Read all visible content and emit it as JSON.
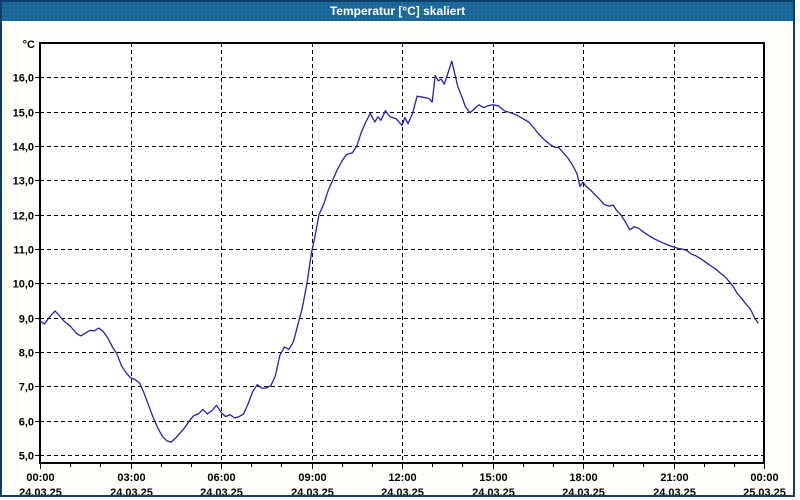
{
  "window": {
    "title": "Temperatur [°C] skaliert"
  },
  "colors": {
    "titlebar_bg": "#1e6b9e",
    "titlebar_dot": "#175c8c",
    "titlebar_text": "#ffffff",
    "window_border": "#0e3f6b",
    "content_bg": "#fdfdf9",
    "plot_bg": "#ffffff",
    "grid": "#000000",
    "axis": "#000000",
    "line": "#2222b2",
    "label": "#000000"
  },
  "chart_data": {
    "type": "line",
    "title": "Temperatur [°C] skaliert",
    "unit_label": "°C",
    "xlabel": "",
    "ylabel": "Temperatur [°C]",
    "grid": true,
    "legend": "none",
    "x_range_hours": [
      0,
      24
    ],
    "y_range": [
      4.77,
      17.0
    ],
    "minor_tick_every_hours": 1,
    "y_ticks": [
      {
        "value": 16,
        "label": "16,0"
      },
      {
        "value": 15,
        "label": "15,0"
      },
      {
        "value": 14,
        "label": "14,0"
      },
      {
        "value": 13,
        "label": "13,0"
      },
      {
        "value": 12,
        "label": "12,0"
      },
      {
        "value": 11,
        "label": "11,0"
      },
      {
        "value": 10,
        "label": "10,0"
      },
      {
        "value": 9,
        "label": "9,0"
      },
      {
        "value": 8,
        "label": "8,0"
      },
      {
        "value": 7,
        "label": "7,0"
      },
      {
        "value": 6,
        "label": "6,0"
      },
      {
        "value": 5,
        "label": "5,0"
      }
    ],
    "x_ticks": [
      {
        "hour": 0,
        "time": "00:00",
        "date": "24.03.25"
      },
      {
        "hour": 3,
        "time": "03:00",
        "date": "24.03.25"
      },
      {
        "hour": 6,
        "time": "06:00",
        "date": "24.03.25"
      },
      {
        "hour": 9,
        "time": "09:00",
        "date": "24.03.25"
      },
      {
        "hour": 12,
        "time": "12:00",
        "date": "24.03.25"
      },
      {
        "hour": 15,
        "time": "15:00",
        "date": "24.03.25"
      },
      {
        "hour": 18,
        "time": "18:00",
        "date": "24.03.25"
      },
      {
        "hour": 21,
        "time": "21:00",
        "date": "24.03.25"
      },
      {
        "hour": 24,
        "time": "00:00",
        "date": "25.03.25"
      }
    ],
    "series": [
      {
        "name": "Temperatur",
        "unit": "°C",
        "points": [
          [
            0.0,
            8.9
          ],
          [
            0.15,
            8.82
          ],
          [
            0.3,
            9.0
          ],
          [
            0.5,
            9.2
          ],
          [
            0.65,
            9.05
          ],
          [
            0.8,
            8.9
          ],
          [
            1.0,
            8.76
          ],
          [
            1.2,
            8.55
          ],
          [
            1.35,
            8.47
          ],
          [
            1.5,
            8.55
          ],
          [
            1.65,
            8.63
          ],
          [
            1.8,
            8.62
          ],
          [
            1.95,
            8.7
          ],
          [
            2.1,
            8.6
          ],
          [
            2.25,
            8.4
          ],
          [
            2.4,
            8.15
          ],
          [
            2.55,
            7.95
          ],
          [
            2.7,
            7.6
          ],
          [
            2.85,
            7.4
          ],
          [
            3.0,
            7.25
          ],
          [
            3.15,
            7.2
          ],
          [
            3.3,
            7.1
          ],
          [
            3.45,
            6.8
          ],
          [
            3.6,
            6.45
          ],
          [
            3.75,
            6.1
          ],
          [
            3.9,
            5.8
          ],
          [
            4.05,
            5.55
          ],
          [
            4.2,
            5.42
          ],
          [
            4.35,
            5.38
          ],
          [
            4.5,
            5.5
          ],
          [
            4.65,
            5.65
          ],
          [
            4.8,
            5.8
          ],
          [
            4.95,
            6.0
          ],
          [
            5.1,
            6.15
          ],
          [
            5.25,
            6.2
          ],
          [
            5.4,
            6.33
          ],
          [
            5.55,
            6.2
          ],
          [
            5.7,
            6.3
          ],
          [
            5.85,
            6.45
          ],
          [
            6.0,
            6.25
          ],
          [
            6.15,
            6.12
          ],
          [
            6.3,
            6.18
          ],
          [
            6.45,
            6.08
          ],
          [
            6.6,
            6.12
          ],
          [
            6.75,
            6.2
          ],
          [
            6.9,
            6.5
          ],
          [
            7.05,
            6.85
          ],
          [
            7.2,
            7.05
          ],
          [
            7.35,
            6.95
          ],
          [
            7.5,
            6.95
          ],
          [
            7.65,
            7.02
          ],
          [
            7.8,
            7.3
          ],
          [
            7.95,
            7.9
          ],
          [
            8.1,
            8.15
          ],
          [
            8.25,
            8.08
          ],
          [
            8.4,
            8.3
          ],
          [
            8.55,
            8.8
          ],
          [
            8.7,
            9.3
          ],
          [
            8.85,
            10.0
          ],
          [
            9.0,
            10.9
          ],
          [
            9.1,
            11.3
          ],
          [
            9.25,
            12.0
          ],
          [
            9.4,
            12.3
          ],
          [
            9.55,
            12.7
          ],
          [
            9.7,
            13.0
          ],
          [
            9.85,
            13.3
          ],
          [
            10.0,
            13.55
          ],
          [
            10.15,
            13.75
          ],
          [
            10.35,
            13.8
          ],
          [
            10.5,
            14.0
          ],
          [
            10.65,
            14.4
          ],
          [
            10.8,
            14.7
          ],
          [
            10.95,
            14.95
          ],
          [
            11.1,
            14.7
          ],
          [
            11.2,
            14.85
          ],
          [
            11.3,
            14.75
          ],
          [
            11.45,
            15.03
          ],
          [
            11.6,
            14.85
          ],
          [
            11.8,
            14.8
          ],
          [
            12.0,
            14.6
          ],
          [
            12.1,
            14.83
          ],
          [
            12.2,
            14.65
          ],
          [
            12.35,
            14.95
          ],
          [
            12.5,
            15.45
          ],
          [
            12.7,
            15.42
          ],
          [
            12.9,
            15.38
          ],
          [
            13.0,
            15.28
          ],
          [
            13.1,
            16.05
          ],
          [
            13.2,
            15.9
          ],
          [
            13.3,
            15.95
          ],
          [
            13.4,
            15.8
          ],
          [
            13.55,
            16.2
          ],
          [
            13.65,
            16.47
          ],
          [
            13.75,
            16.1
          ],
          [
            13.85,
            15.73
          ],
          [
            14.0,
            15.4
          ],
          [
            14.1,
            15.15
          ],
          [
            14.25,
            14.97
          ],
          [
            14.4,
            15.08
          ],
          [
            14.55,
            15.2
          ],
          [
            14.7,
            15.12
          ],
          [
            14.85,
            15.17
          ],
          [
            15.0,
            15.2
          ],
          [
            15.2,
            15.17
          ],
          [
            15.4,
            15.02
          ],
          [
            15.6,
            14.97
          ],
          [
            15.8,
            14.9
          ],
          [
            16.0,
            14.8
          ],
          [
            16.2,
            14.7
          ],
          [
            16.35,
            14.55
          ],
          [
            16.5,
            14.38
          ],
          [
            16.7,
            14.2
          ],
          [
            16.9,
            14.05
          ],
          [
            17.05,
            13.97
          ],
          [
            17.2,
            13.95
          ],
          [
            17.35,
            13.8
          ],
          [
            17.5,
            13.65
          ],
          [
            17.65,
            13.45
          ],
          [
            17.8,
            13.2
          ],
          [
            17.9,
            12.82
          ],
          [
            18.0,
            12.95
          ],
          [
            18.1,
            12.83
          ],
          [
            18.25,
            12.72
          ],
          [
            18.4,
            12.58
          ],
          [
            18.55,
            12.45
          ],
          [
            18.7,
            12.3
          ],
          [
            18.85,
            12.25
          ],
          [
            19.0,
            12.28
          ],
          [
            19.1,
            12.14
          ],
          [
            19.25,
            12.0
          ],
          [
            19.4,
            11.8
          ],
          [
            19.55,
            11.56
          ],
          [
            19.7,
            11.65
          ],
          [
            19.85,
            11.6
          ],
          [
            20.0,
            11.5
          ],
          [
            20.2,
            11.38
          ],
          [
            20.4,
            11.28
          ],
          [
            20.6,
            11.2
          ],
          [
            20.8,
            11.12
          ],
          [
            21.0,
            11.06
          ],
          [
            21.15,
            11.02
          ],
          [
            21.3,
            11.0
          ],
          [
            21.45,
            10.95
          ],
          [
            21.6,
            10.85
          ],
          [
            21.75,
            10.8
          ],
          [
            21.9,
            10.72
          ],
          [
            22.05,
            10.63
          ],
          [
            22.2,
            10.53
          ],
          [
            22.4,
            10.42
          ],
          [
            22.55,
            10.3
          ],
          [
            22.7,
            10.2
          ],
          [
            22.85,
            10.05
          ],
          [
            23.0,
            9.88
          ],
          [
            23.1,
            9.72
          ],
          [
            23.25,
            9.57
          ],
          [
            23.4,
            9.4
          ],
          [
            23.55,
            9.25
          ],
          [
            23.7,
            8.98
          ],
          [
            23.8,
            8.85
          ]
        ]
      }
    ]
  }
}
